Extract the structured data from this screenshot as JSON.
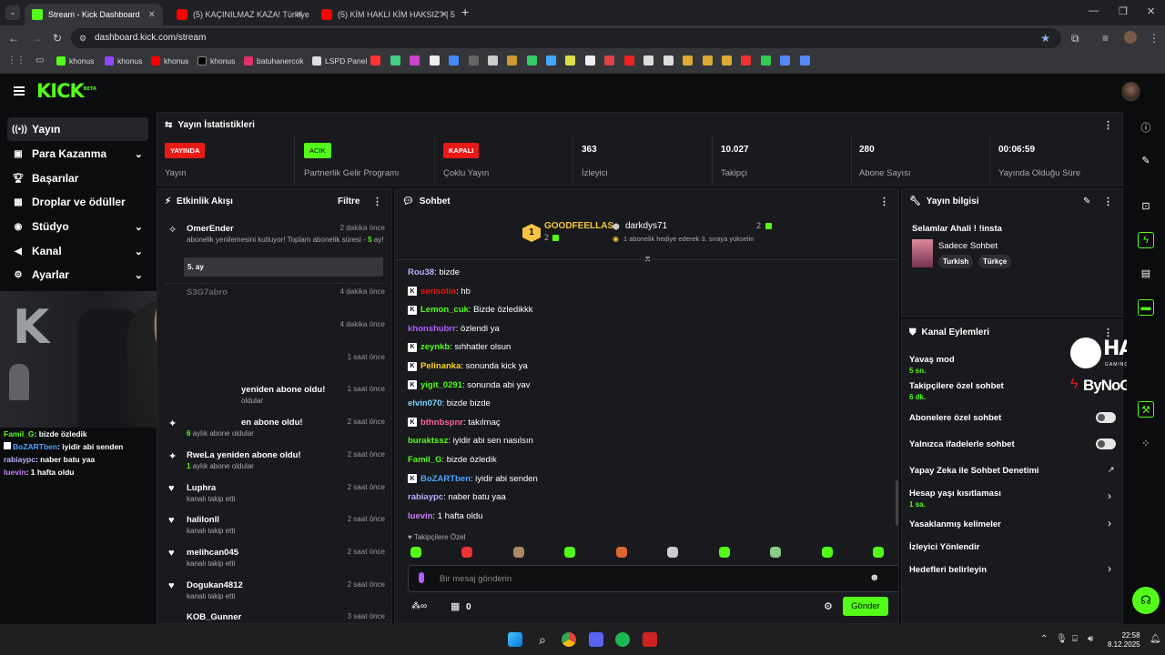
{
  "browser": {
    "tabs": [
      {
        "title": "Stream - Kick Dashboard",
        "icon": "kick-icon"
      },
      {
        "title": "(5) KAÇINILMAZ KAZA! Türkiye",
        "icon": "youtube-icon"
      },
      {
        "title": "(5) KİM HAKLI KİM HAKSIZ? | 5",
        "icon": "youtube-icon"
      }
    ],
    "new_tab": "+",
    "url": "dashboard.kick.com/stream",
    "bookmarks": [
      "khonus",
      "khonus",
      "khonus",
      "khonus",
      "batuhanercok",
      "LSPD Panel"
    ]
  },
  "sidebar": {
    "items": [
      {
        "label": "Yayın",
        "icon": "broadcast-icon"
      },
      {
        "label": "Para Kazanma",
        "icon": "money-icon"
      },
      {
        "label": "Başarılar",
        "icon": "trophy-icon"
      },
      {
        "label": "Droplar ve ödüller",
        "icon": "gift-icon"
      },
      {
        "label": "Stüdyo",
        "icon": "studio-icon"
      },
      {
        "label": "Kanal",
        "icon": "megaphone-icon"
      },
      {
        "label": "Ayarlar",
        "icon": "gear-icon"
      }
    ]
  },
  "webcam_chat": [
    {
      "user": "Famil_G",
      "text": ": bizde özledik"
    },
    {
      "user": "BoZARTben",
      "text": ": iyidir abi senden"
    },
    {
      "user": "rabiaypc",
      "text": ": naber batu yaa"
    },
    {
      "user": "luevin",
      "text": ": 1 hafta oldu"
    }
  ],
  "stats": {
    "title": "Yayın İstatistikleri",
    "items": [
      {
        "badge": "YAYINDA",
        "label": "Yayın"
      },
      {
        "badge": "ACIK",
        "label": "Partnerlik Gelir Programı"
      },
      {
        "badge": "KAPALI",
        "label": "Çoklu Yayın"
      },
      {
        "value": "363",
        "label": "İzleyici"
      },
      {
        "value": "10.027",
        "label": "Takipçi"
      },
      {
        "value": "280",
        "label": "Abone Sayısı"
      },
      {
        "value": "00:06:59",
        "label": "Yayında Olduğu Süre"
      }
    ]
  },
  "activity": {
    "title": "Etkinlik Akışı",
    "filter": "Filtre",
    "items": [
      {
        "name": "OmerEnder",
        "time": "2 dakika önce",
        "sub": "abonelik yenilemesini kutluyor! Toplam abonelik süresi -",
        "sub2": "5",
        "sub3": "ay!",
        "msg": "5. ay"
      },
      {
        "name": "S3G7abro",
        "time": "4 dakika önce"
      },
      {
        "name": "",
        "time": "4 dakika önce"
      },
      {
        "name": "",
        "time": "1 saat önce"
      },
      {
        "name": "yeniden abone oldu!",
        "time": "1 saat önce",
        "sub": "oldular"
      },
      {
        "name": "en abone oldu!",
        "time": "2 saat önce",
        "sub_num": "6",
        "sub": "aylık abone oldular"
      },
      {
        "name": "RweLa yeniden abone oldu!",
        "time": "2 saat önce",
        "sub_num": "1",
        "sub": "aylık abone oldular"
      },
      {
        "name": "Luphra",
        "time": "2 saat önce",
        "sub": "kanalı takip etti"
      },
      {
        "name": "halilonll",
        "time": "2 saat önce",
        "sub": "kanalı takip etti"
      },
      {
        "name": "melihcan045",
        "time": "2 saat önce",
        "sub": "kanalı takip etti"
      },
      {
        "name": "Dogukan4812",
        "time": "2 saat önce",
        "sub": "kanalı takip etti"
      },
      {
        "name": "KOB_Gunner",
        "time": "3 saat önce"
      }
    ]
  },
  "chat": {
    "title": "Sohbet",
    "pinned_left": {
      "name": "GOODFEELLAS",
      "count": "2",
      "rank": "1"
    },
    "pinned_right": {
      "name": "darkdys71",
      "count": "2",
      "note": "1 abonelik hediye ederek 3. sıraya yükselin"
    },
    "messages": [
      {
        "user": "Rou38",
        "text": ": bizde",
        "color": "#b3b3ff",
        "badge": false
      },
      {
        "user": "serisolin",
        "text": ": hb",
        "color": "#e91916",
        "badge": true
      },
      {
        "user": "Lemon_cuk",
        "text": ": Bizde özledikkk",
        "color": "#53fc18",
        "badge": true
      },
      {
        "user": "khonshubrr",
        "text": ": özlendi ya",
        "color": "#b45cff",
        "badge": false
      },
      {
        "user": "zeynkb",
        "text": ": sıhhatler olsun",
        "color": "#53fc18",
        "badge": true
      },
      {
        "user": "Pelinanka",
        "text": ": sonunda kick ya",
        "color": "#ffd21c",
        "badge": true
      },
      {
        "user": "yigit_0291",
        "text": ": sonunda abi yav",
        "color": "#53fc18",
        "badge": true
      },
      {
        "user": "elvin070",
        "text": ": bizde bizde",
        "color": "#7fd1ff",
        "badge": false
      },
      {
        "user": "bthnbspnr",
        "text": ": takılmaç",
        "color": "#ff5fa0",
        "badge": true
      },
      {
        "user": "buraktssz",
        "text": ": iyidir abi sen nasılsın",
        "color": "#53fc18",
        "badge": false
      },
      {
        "user": "Famil_G",
        "text": ": bizde özledik",
        "color": "#53fc18",
        "badge": false
      },
      {
        "user": "BoZARTben",
        "text": ": iyidir abi senden",
        "color": "#4aa3ff",
        "badge": true
      },
      {
        "user": "rabiaypc",
        "text": ": naber batu yaa",
        "color": "#b3b3ff",
        "badge": false
      },
      {
        "user": "luevin",
        "text": ": 1 hafta oldu",
        "color": "#c77dff",
        "badge": false
      }
    ],
    "followers_only": "Takipçilere Özel",
    "placeholder": "Bir mesaj gönderin",
    "points": "0",
    "send": "Gönder"
  },
  "stream_info": {
    "title": "Yayın bilgisi",
    "stream_title": "Selamlar Ahali ! !insta",
    "category": "Sadece Sohbet",
    "tags": [
      "Turkish",
      "Türkçe"
    ]
  },
  "channel_actions": {
    "title": "Kanal Eylemleri",
    "items": [
      {
        "label": "Yavaş mod",
        "sub": "5 sn."
      },
      {
        "label": "Takipçilere özel sohbet",
        "sub": "6 dk."
      },
      {
        "label": "Abonelere özel sohbet",
        "toggle": true
      },
      {
        "label": "Yalnızca ifadelerle sohbet",
        "toggle": true
      },
      {
        "label": "Yapay Zeka ile Sohbet Denetimi"
      },
      {
        "label": "Hesap yaşı kısıtlaması",
        "sub": "1 sa."
      },
      {
        "label": "Yasaklanmış kelimeler"
      },
      {
        "label": "İzleyici Yönlendir"
      },
      {
        "label": "Hedefleri belirleyin"
      }
    ]
  },
  "overlay": {
    "brand1": "HAWK",
    "brand1_sub": "GAMING CHAIR",
    "brand2": "ByNoGame"
  },
  "taskbar": {
    "time": "22:58",
    "date": "8.12.2025"
  },
  "colors": {
    "kick_green": "#53fc18",
    "live_red": "#e91916",
    "panel_bg": "#191a1d"
  }
}
